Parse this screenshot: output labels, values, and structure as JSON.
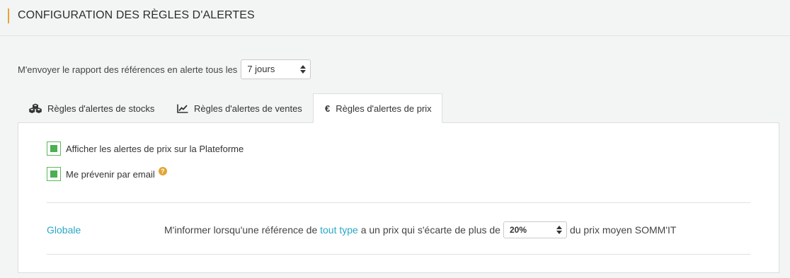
{
  "header": {
    "title": "CONFIGURATION DES RÈGLES D'ALERTES"
  },
  "report": {
    "label": "M'envoyer le rapport des références en alerte tous les",
    "frequency": "7 jours"
  },
  "tabs": [
    {
      "label": "Règles d'alertes de stocks",
      "icon": "cubes-icon",
      "active": false
    },
    {
      "label": "Règles d'alertes de ventes",
      "icon": "line-chart-icon",
      "active": false
    },
    {
      "label": "Règles d'alertes de prix",
      "icon": "euro-icon",
      "active": true
    }
  ],
  "options": {
    "show_on_platform": {
      "label": "Afficher les alertes de prix sur la Plateforme",
      "checked": true
    },
    "notify_email": {
      "label": "Me prévenir par email",
      "checked": true,
      "help": "?"
    }
  },
  "rule": {
    "name": "Globale",
    "text_before": "M'informer lorsqu'une référence de",
    "type_link": "tout type",
    "text_middle": "a un prix qui s'écarte de plus de",
    "threshold": "20%",
    "text_after": "du prix moyen SOMM'IT"
  },
  "colors": {
    "accent": "#e2a536",
    "link": "#2ba7c6",
    "check": "#4caf50"
  }
}
